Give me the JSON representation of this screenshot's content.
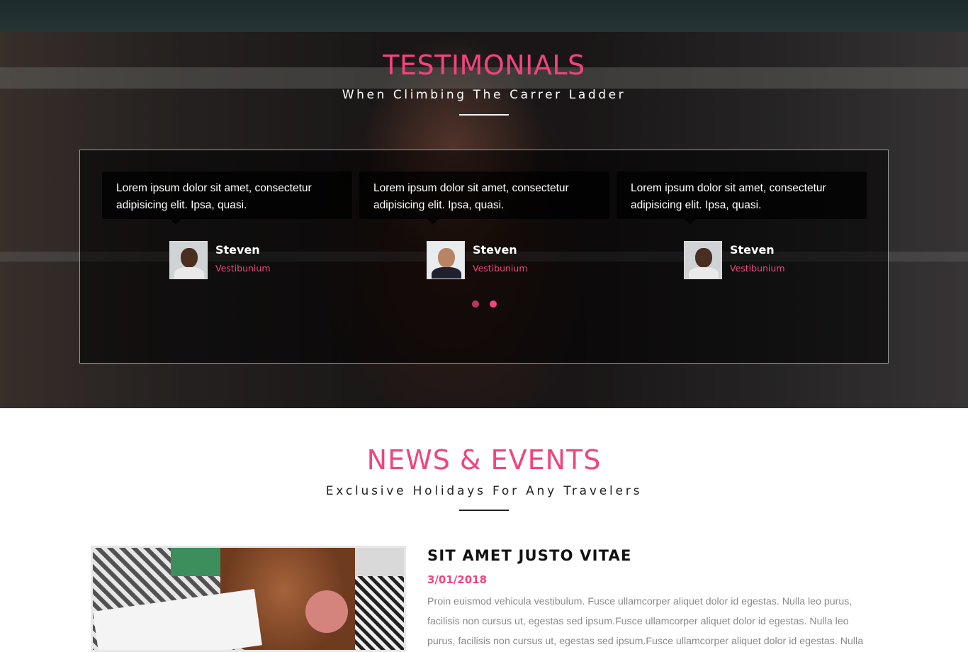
{
  "colors": {
    "accent": "#f0457f",
    "dot_inactive": "#d63f72",
    "dot_active": "#f0457f"
  },
  "testimonials": {
    "title": "TESTIMONIALS",
    "subtitle": "When Climbing The Carrer Ladder",
    "cards": [
      {
        "quote": "Lorem ipsum dolor sit amet, consectetur adipisicing elit. Ipsa, quasi.",
        "name": "Steven",
        "role": "Vestibunium",
        "avatar": "person-avatar"
      },
      {
        "quote": "Lorem ipsum dolor sit amet, consectetur adipisicing elit. Ipsa, quasi.",
        "name": "Steven",
        "role": "Vestibunium",
        "avatar": "person-avatar"
      },
      {
        "quote": "Lorem ipsum dolor sit amet, consectetur adipisicing elit. Ipsa, quasi.",
        "name": "Steven",
        "role": "Vestibunium",
        "avatar": "person-avatar"
      }
    ],
    "carousel": {
      "page_count": 2,
      "active_index": 1
    }
  },
  "news": {
    "title": "NEWS & EVENTS",
    "subtitle": "Exclusive Holidays For Any Travelers",
    "item": {
      "heading": "SIT AMET JUSTO VITAE",
      "date": "3/01/2018",
      "text": "Proin euismod vehicula vestibulum. Fusce ullamcorper aliquet dolor id egestas. Nulla leo purus, facilisis non cursus ut, egestas sed ipsum.Fusce ullamcorper aliquet dolor id egestas. Nulla leo purus, facilisis non cursus ut, egestas sed ipsum.Fusce ullamcorper aliquet dolor id egestas. Nulla"
    }
  }
}
